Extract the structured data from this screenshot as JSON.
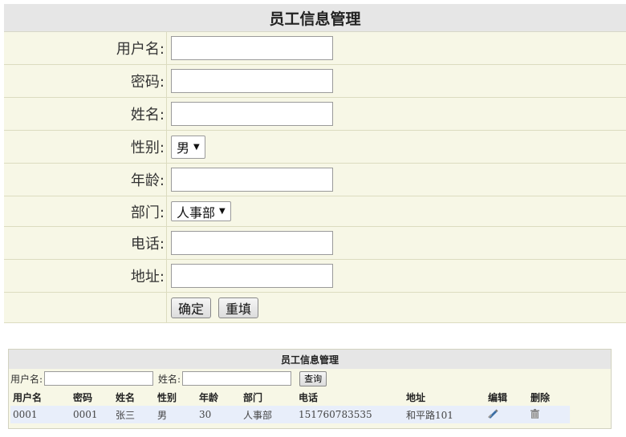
{
  "form": {
    "title": "员工信息管理",
    "labels": {
      "username": "用户名:",
      "password": "密码:",
      "name": "姓名:",
      "gender": "性别:",
      "age": "年龄:",
      "department": "部门:",
      "phone": "电话:",
      "address": "地址:"
    },
    "gender_value": "男",
    "department_value": "人事部",
    "submit_label": "确定",
    "reset_label": "重填"
  },
  "list": {
    "title": "员工信息管理",
    "search_username_label": "用户名:",
    "search_name_label": "姓名:",
    "search_button": "查询",
    "columns": [
      "用户名",
      "密码",
      "姓名",
      "性别",
      "年龄",
      "部门",
      "电话",
      "地址",
      "编辑",
      "删除"
    ],
    "rows": [
      {
        "username": "0001",
        "password": "0001",
        "name": "张三",
        "gender": "男",
        "age": "30",
        "department": "人事部",
        "phone": "151760783535",
        "address": "和平路101",
        "edit_icon": "edit-icon",
        "delete_icon": "trash-icon"
      }
    ]
  }
}
